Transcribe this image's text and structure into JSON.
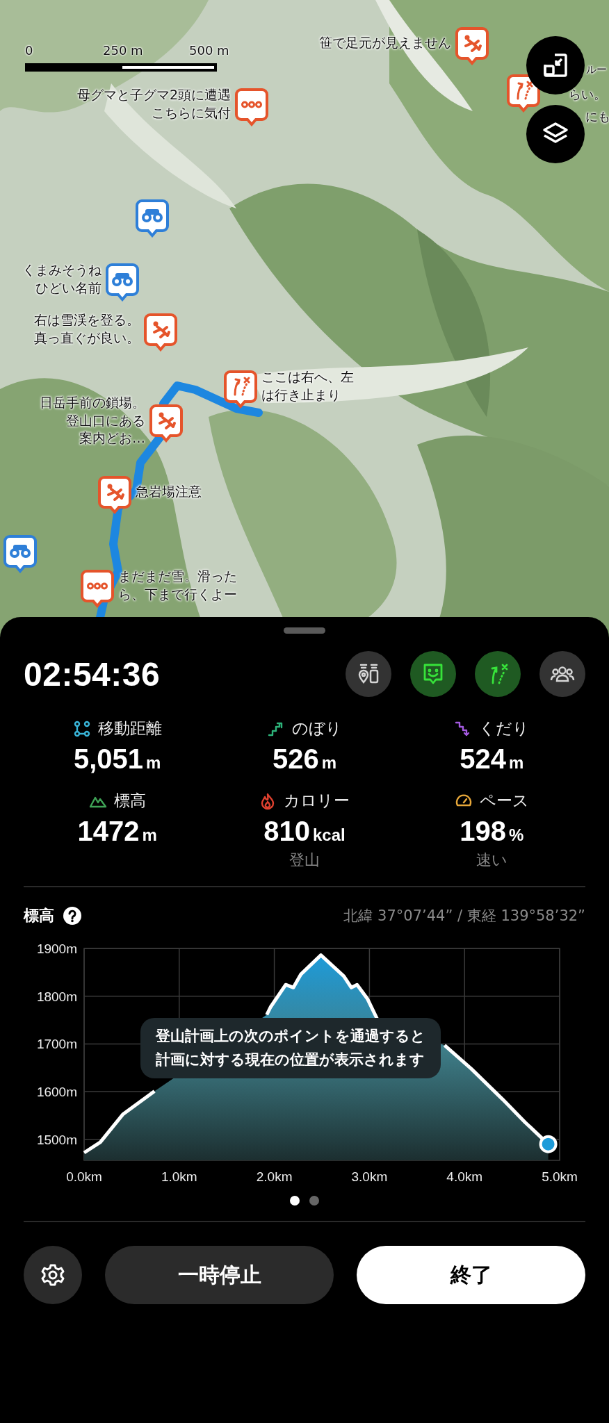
{
  "map": {
    "scale_bar": {
      "labels": [
        "0",
        "250 m",
        "500 m"
      ]
    },
    "markers": [
      {
        "kind": "climb",
        "lines": [
          "笹で足元が見えません"
        ]
      },
      {
        "kind": "chat",
        "lines": [
          "母グマと子グマ2頭に遭遇",
          "こちらに気付"
        ]
      },
      {
        "kind": "route",
        "lines": [
          "ルー",
          "らい。",
          "にも"
        ]
      },
      {
        "kind": "view"
      },
      {
        "kind": "view",
        "lines": [
          "くまみそうね",
          "ひどい名前"
        ]
      },
      {
        "kind": "climb",
        "lines": [
          "右は雪渓を登る。",
          "真っ直ぐが良い。"
        ]
      },
      {
        "kind": "route",
        "lines": [
          "ここは右へ、左",
          "は行き止まり"
        ]
      },
      {
        "kind": "climb",
        "lines": [
          "日岳手前の鎖場。",
          "登山口にある",
          "案内どお…"
        ]
      },
      {
        "kind": "climb",
        "lines": [
          "急岩場注意"
        ]
      },
      {
        "kind": "view"
      },
      {
        "kind": "chat",
        "lines": [
          "まだまだ雪。滑った",
          "ら、下まで行くよー"
        ]
      }
    ],
    "buttons": [
      {
        "kind": "fit"
      },
      {
        "kind": "layers"
      }
    ]
  },
  "panel": {
    "timer": "02:54:36",
    "toggles": [
      {
        "kind": "beacon",
        "on": false
      },
      {
        "kind": "comment",
        "on": true
      },
      {
        "kind": "route",
        "on": true
      },
      {
        "kind": "group",
        "on": false
      }
    ],
    "stats": [
      {
        "kind": "distance",
        "label": "移動距離",
        "value": "5,051",
        "unit": "m"
      },
      {
        "kind": "ascent",
        "label": "のぼり",
        "value": "526",
        "unit": "m"
      },
      {
        "kind": "descent",
        "label": "くだり",
        "value": "524",
        "unit": "m"
      },
      {
        "kind": "altitude",
        "label": "標高",
        "value": "1472",
        "unit": "m"
      },
      {
        "kind": "calories",
        "label": "カロリー",
        "value": "810",
        "unit": "kcal",
        "note": "登山"
      },
      {
        "kind": "pace",
        "label": "ペース",
        "value": "198",
        "unit": "%",
        "note": "速い"
      }
    ],
    "elevation": {
      "title": "標高",
      "coordinates": "北緯 37°07’44” / 東経 139°58’32”",
      "overlay_lines": [
        "登山計画上の次のポイントを通過すると",
        "計画に対する現在の位置が表示されます"
      ],
      "chart_data": {
        "type": "area",
        "grid": true,
        "x": [
          0,
          0.17,
          0.41,
          0.74,
          1.15,
          1.55,
          1.8,
          1.92,
          1.96,
          2.12,
          2.2,
          2.28,
          2.49,
          2.73,
          2.81,
          2.87,
          2.98,
          3.08,
          3.38,
          3.79,
          4.07,
          4.4,
          4.64,
          4.88
        ],
        "series": [
          {
            "color": "#1e9bd9",
            "values": [
              1472,
              1494,
              1553,
              1601,
              null,
              null,
              null,
              1761,
              1777,
              1824,
              1818,
              1846,
              1886,
              1842,
              1818,
              1824,
              1794,
              1753,
              null,
              1697,
              1648,
              1584,
              1535,
              1490
            ]
          }
        ],
        "xlim": [
          0,
          5
        ],
        "ylim": [
          1456,
          1900
        ],
        "xticks": [
          {
            "value": 0,
            "label": "0.0km"
          },
          {
            "value": 1,
            "label": "1.0km"
          },
          {
            "value": 2,
            "label": "2.0km"
          },
          {
            "value": 3,
            "label": "3.0km"
          },
          {
            "value": 4,
            "label": "4.0km"
          },
          {
            "value": 5,
            "label": "5.0km"
          }
        ],
        "yticks": [
          {
            "value": 1500,
            "label": "1500m"
          },
          {
            "value": 1600,
            "label": "1600m"
          },
          {
            "value": 1700,
            "label": "1700m"
          },
          {
            "value": 1800,
            "label": "1800m"
          },
          {
            "value": 1900,
            "label": "1900m"
          }
        ]
      }
    },
    "pages": [
      {
        "selected": true
      },
      {
        "selected": false
      }
    ],
    "buttons": [
      {
        "kind": "settings"
      },
      {
        "kind": "pause",
        "label": "一時停止"
      },
      {
        "kind": "finish",
        "label": "終了"
      }
    ]
  }
}
